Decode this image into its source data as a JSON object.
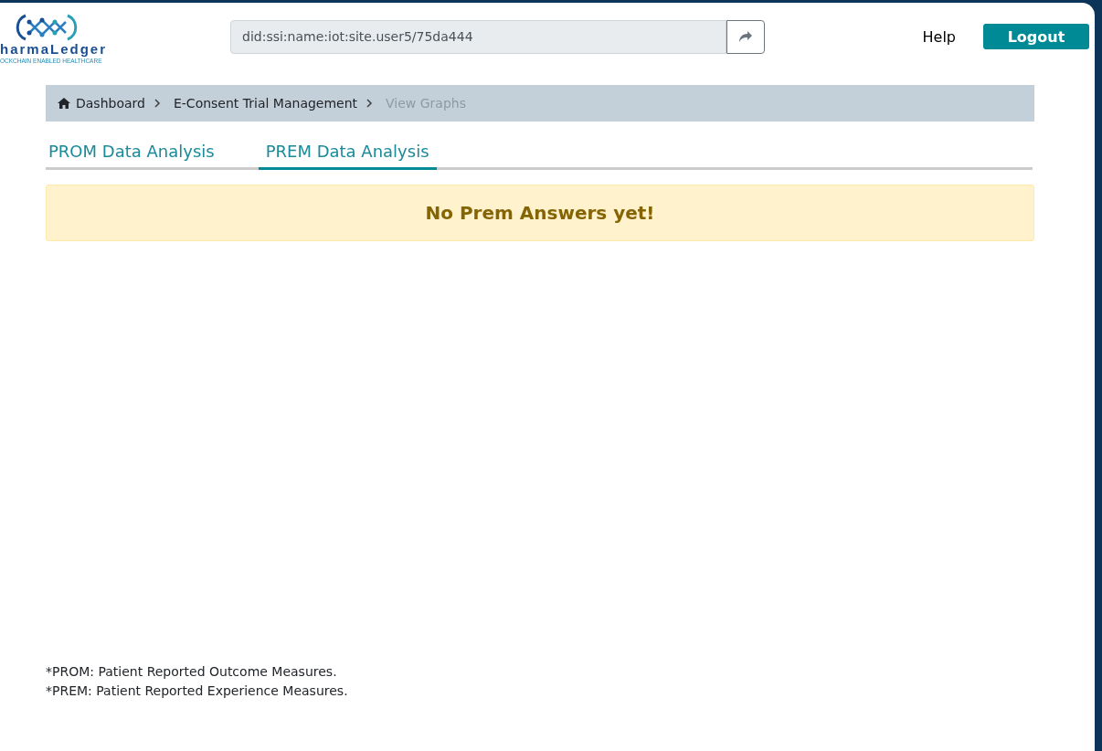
{
  "logo": {
    "name": "harmaLedger",
    "tagline": "OCKCHAIN ENABLED HEALTHCARE"
  },
  "identity": {
    "value": "did:ssi:name:iot:site.user5/75da444"
  },
  "nav": {
    "help": "Help",
    "logout": "Logout"
  },
  "breadcrumb": [
    {
      "label": "Dashboard",
      "kind": "home",
      "current": false
    },
    {
      "label": "E-Consent Trial Management",
      "kind": "link",
      "current": false
    },
    {
      "label": "View Graphs",
      "kind": "link",
      "current": true
    }
  ],
  "tabs": [
    {
      "label": "PROM Data Analysis",
      "selected": false
    },
    {
      "label": "PREM Data Analysis",
      "selected": true
    }
  ],
  "alert": "No Prem Answers yet!",
  "footnotes": [
    "*PROM: Patient Reported Outcome Measures.",
    "*PREM: Patient Reported Experience Measures."
  ]
}
